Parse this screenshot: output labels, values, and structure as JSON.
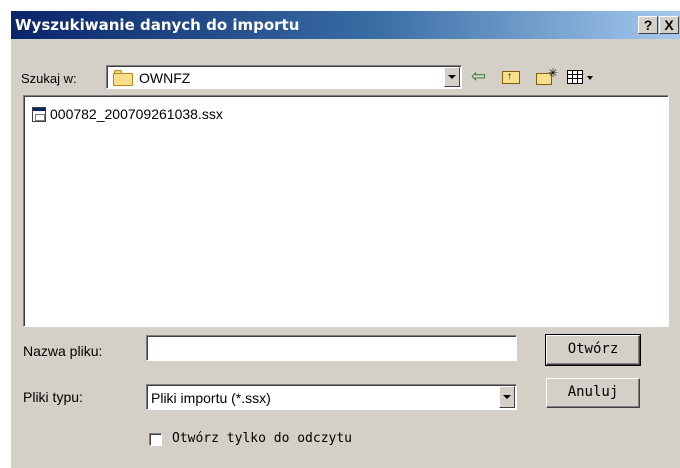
{
  "window": {
    "title": "Wyszukiwanie danych do importu",
    "help_label": "?",
    "close_label": "X"
  },
  "lookin": {
    "label": "Szukaj w:",
    "value": "OWNFZ",
    "folder_icon": "folder-icon"
  },
  "toolbar": {
    "back_icon": "back-arrow-icon",
    "up_icon": "up-one-level-icon",
    "new_folder_icon": "new-folder-icon",
    "view_menu_icon": "view-menu-icon"
  },
  "files": [
    {
      "name": "000782_200709261038.ssx",
      "icon": "file-icon"
    }
  ],
  "filename": {
    "label": "Nazwa pliku:",
    "value": ""
  },
  "filetype": {
    "label": "Pliki typu:",
    "value": "Pliki importu (*.ssx)"
  },
  "readonly": {
    "label": "Otwórz tylko do odczytu",
    "checked": false
  },
  "buttons": {
    "open": "Otwórz",
    "cancel": "Anuluj"
  },
  "colors": {
    "titlebar_start": "#0a246a",
    "titlebar_end": "#a6caf0",
    "dialog_bg": "#d4d0c8"
  }
}
